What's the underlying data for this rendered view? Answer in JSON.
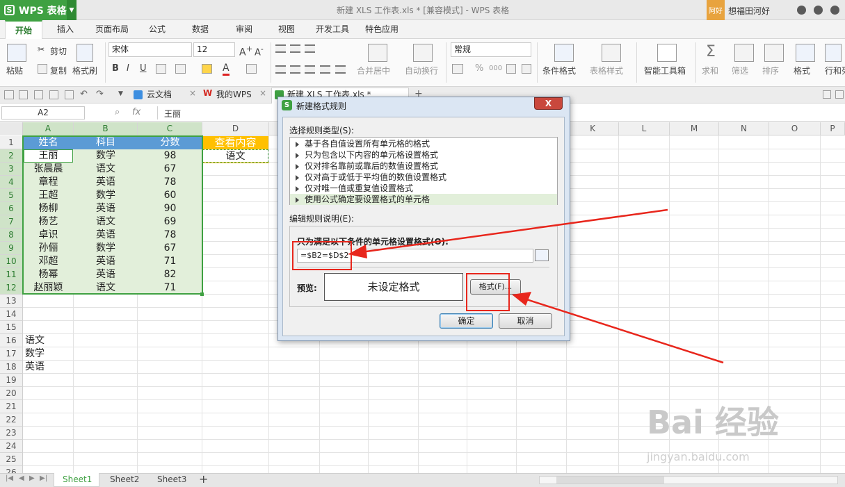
{
  "app": {
    "name": "WPS 表格",
    "doc_title": "新建 XLS 工作表.xls * [兼容模式] - WPS 表格",
    "user_tag": "阿好",
    "user_name": "想福田河好"
  },
  "menu_tabs": [
    "开始",
    "插入",
    "页面布局",
    "公式",
    "数据",
    "审阅",
    "视图",
    "开发工具",
    "特色应用"
  ],
  "ribbon": {
    "paste": "粘贴",
    "cut": "剪切",
    "copy": "复制",
    "format_painter": "格式刷",
    "font": "宋体",
    "font_size": "12",
    "bold": "B",
    "italic": "I",
    "underline": "U",
    "merge": "合并居中",
    "wrap": "自动换行",
    "number_format": "常规",
    "percent": "%",
    "thousands": "000",
    "cond_format": "条件格式",
    "table_style": "表格样式",
    "smart_toolbox": "智能工具箱",
    "sum": "求和",
    "filter": "筛选",
    "sort": "排序",
    "format": "格式",
    "rowcol": "行和列"
  },
  "doc_tabs": [
    "云文档",
    "我的WPS",
    "新建 XLS 工作表.xls *"
  ],
  "formula_bar": {
    "cell_ref": "A2",
    "fx": "fx",
    "content": "王丽"
  },
  "columns": [
    "A",
    "B",
    "C",
    "D",
    "E",
    "F",
    "G",
    "H",
    "I",
    "J",
    "K",
    "L",
    "M",
    "N",
    "O",
    "P"
  ],
  "rows": [
    "1",
    "2",
    "3",
    "4",
    "5",
    "6",
    "7",
    "8",
    "9",
    "10",
    "11",
    "12",
    "13",
    "14",
    "15",
    "16",
    "17",
    "18",
    "19",
    "20",
    "21",
    "22",
    "23",
    "24",
    "25",
    "26"
  ],
  "table": {
    "headers": [
      "姓名",
      "科目",
      "分数"
    ],
    "rows": [
      [
        "王丽",
        "数学",
        "98"
      ],
      [
        "张晨晨",
        "语文",
        "67"
      ],
      [
        "章程",
        "英语",
        "78"
      ],
      [
        "王超",
        "数学",
        "60"
      ],
      [
        "杨柳",
        "英语",
        "90"
      ],
      [
        "杨艺",
        "语文",
        "69"
      ],
      [
        "卓识",
        "英语",
        "78"
      ],
      [
        "孙俪",
        "数学",
        "67"
      ],
      [
        "邓超",
        "英语",
        "71"
      ],
      [
        "杨幂",
        "英语",
        "82"
      ],
      [
        "赵丽颖",
        "语文",
        "71"
      ]
    ]
  },
  "lookup": {
    "header": "查看内容",
    "value": "语文"
  },
  "list_items": [
    "语文",
    "数学",
    "英语"
  ],
  "sheets": [
    "Sheet1",
    "Sheet2",
    "Sheet3"
  ],
  "add_sheet": "+",
  "dialog": {
    "title": "新建格式规则",
    "close": "X",
    "select_label": "选择规则类型(S):",
    "rule_types": [
      "基于各自值设置所有单元格的格式",
      "只为包含以下内容的单元格设置格式",
      "仅对排名靠前或靠后的数值设置格式",
      "仅对高于或低于平均值的数值设置格式",
      "仅对唯一值或重复值设置格式",
      "使用公式确定要设置格式的单元格"
    ],
    "edit_label": "编辑规则说明(E):",
    "condition_label": "只为满足以下条件的单元格设置格式(O):",
    "formula": "=$B2=$D$2",
    "preview_label": "预览:",
    "preview_text": "未设定格式",
    "format_button": "格式(F)...",
    "ok": "确定",
    "cancel": "取消"
  },
  "watermark": {
    "brand": "Bai 经验",
    "url": "jingyan.baidu.com"
  },
  "colors": {
    "wps_green": "#3fa142",
    "header_blue": "#5b9bd5",
    "lookup_orange": "#ffc000",
    "data_fill": "#e2efda",
    "annotation_red": "#e8261c"
  }
}
